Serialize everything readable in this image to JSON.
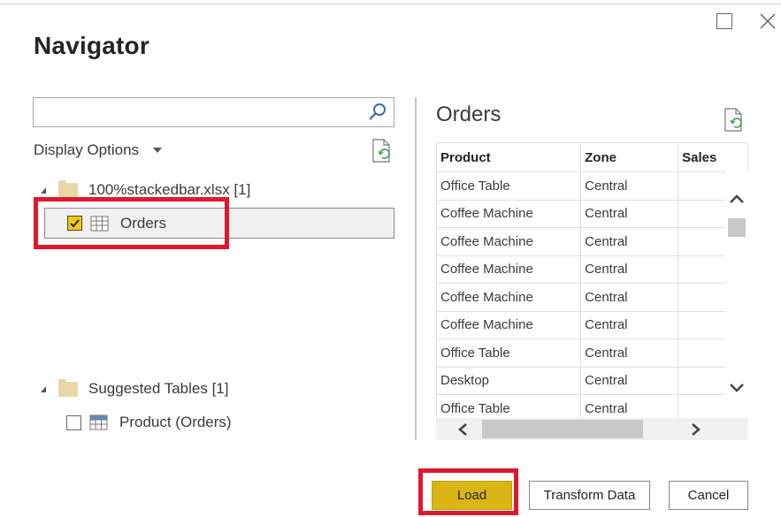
{
  "dialog": {
    "title": "Navigator"
  },
  "search": {
    "placeholder": "",
    "value": ""
  },
  "display_options": {
    "label": "Display Options"
  },
  "tree": {
    "file_node": {
      "label": "100%stackedbar.xlsx [1]"
    },
    "file_items": [
      {
        "label": "Orders",
        "checked": true,
        "icon": "sheet-table-icon"
      }
    ],
    "suggested_node": {
      "label": "Suggested Tables [1]"
    },
    "suggested_items": [
      {
        "label": "Product (Orders)",
        "checked": false,
        "icon": "table-icon"
      }
    ]
  },
  "preview": {
    "title": "Orders",
    "columns": [
      "Product",
      "Zone",
      "Sales"
    ],
    "rows": [
      [
        "Office Table",
        "Central",
        ""
      ],
      [
        "Coffee Machine",
        "Central",
        ""
      ],
      [
        "Coffee Machine",
        "Central",
        ""
      ],
      [
        "Coffee Machine",
        "Central",
        ""
      ],
      [
        "Coffee Machine",
        "Central",
        ""
      ],
      [
        "Coffee Machine",
        "Central",
        ""
      ],
      [
        "Office Table",
        "Central",
        ""
      ],
      [
        "Desktop",
        "Central",
        ""
      ],
      [
        "Office Table",
        "Central",
        ""
      ]
    ]
  },
  "buttons": {
    "load": "Load",
    "transform": "Transform Data",
    "cancel": "Cancel"
  },
  "colors": {
    "load_accent": "#d9b515",
    "checkbox_checked": "#f2c811",
    "highlight_red": "#e0182d",
    "folder": "#e9d8a6"
  }
}
